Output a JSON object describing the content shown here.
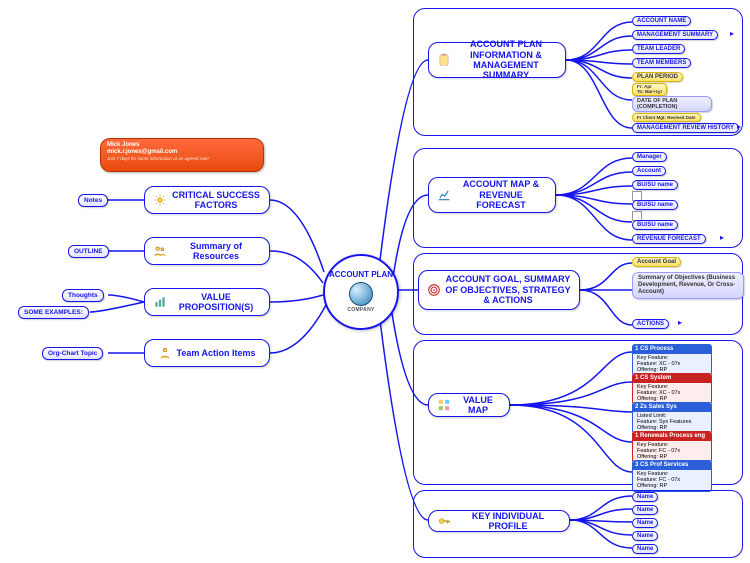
{
  "center": {
    "title": "ACCOUNT PLAN",
    "company": "COMPANY"
  },
  "contact": {
    "name": "Mick Jones",
    "email": "mick.r.jones@gmail.com",
    "note": "Just 7 days for some information at an agreed rate!"
  },
  "left": {
    "csf": {
      "title": "CRITICAL SUCCESS FACTORS",
      "child": "Notes"
    },
    "sor": {
      "title": "Summary of Resources",
      "child": "OUTLINE"
    },
    "vp": {
      "title": "VALUE PROPOSITION(S)",
      "child1": "Thoughts",
      "child2": "SOME EXAMPLES:"
    },
    "tai": {
      "title": "Team Action Items",
      "child": "Org-Chart Topic"
    }
  },
  "right": {
    "apims": {
      "title": "ACCOUNT PLAN INFORMATION & MANAGEMENT SUMMARY",
      "items": [
        "ACCOUNT NAME",
        "MANAGEMENT SUMMARY",
        "TEAM LEADER",
        "TEAM MEMBERS",
        "PLAN PERIOD",
        "DATE OF PLAN (COMPLETION)",
        "MANAGEMENT REVIEW HISTORY"
      ],
      "plan_period_sub": [
        "Fr: Apr",
        "To: Mar+1yr"
      ],
      "date_sub": "Fr Client Mgt: Revised Date"
    },
    "amrf": {
      "title": "ACCOUNT MAP & REVENUE FORECAST",
      "items": [
        "Manager",
        "Account",
        "BU/SU name",
        "BU/SU name",
        "BU/SU name",
        "REVENUE FORECAST"
      ]
    },
    "agsosa": {
      "title": "ACCOUNT GOAL, SUMMARY OF OBJECTIVES, STRATEGY & ACTIONS",
      "goal": "Account Goal",
      "summary": "Summary of Objectives (Business Development, Revenue, Or Cross-Account)",
      "actions": "ACTIONS"
    },
    "vmap": {
      "title": "VALUE MAP",
      "items": [
        {
          "n": "1",
          "t": "CS Process",
          "c": "blue",
          "l": "Key Feature:\nFeature: XC - 07x\nOffering: RP"
        },
        {
          "n": "1",
          "t": "CS System",
          "c": "red",
          "l": "Key Feature:\nFeature: XC - 07x\nOffering: RP"
        },
        {
          "n": "2",
          "t": "Zs Sales Sys",
          "c": "blue",
          "l": "Listed Limit:\nFeature: Sys Features\nOffering: RP"
        },
        {
          "n": "1",
          "t": "Renewals Process eng",
          "c": "red",
          "l": "Key Feature:\nFeature: FC - 07x\nOffering: RP"
        },
        {
          "n": "3",
          "t": "CS Prof Services",
          "c": "blue",
          "l": "Key Feature:\nFeature: FC - 07x\nOffering: RP"
        }
      ]
    },
    "kip": {
      "title": "KEY INDIVIDUAL PROFILE",
      "items": [
        "Name",
        "Name",
        "Name",
        "Name",
        "Name"
      ]
    }
  },
  "chart_data": {
    "type": "mindmap",
    "root": "ACCOUNT PLAN",
    "children": [
      {
        "side": "left",
        "label": "CRITICAL SUCCESS FACTORS",
        "children": [
          "Notes"
        ]
      },
      {
        "side": "left",
        "label": "Summary of Resources",
        "children": [
          "OUTLINE"
        ]
      },
      {
        "side": "left",
        "label": "VALUE PROPOSITION(S)",
        "children": [
          "Thoughts",
          "SOME EXAMPLES:"
        ]
      },
      {
        "side": "left",
        "label": "Team Action Items",
        "children": [
          "Org-Chart Topic"
        ]
      },
      {
        "side": "right",
        "label": "ACCOUNT PLAN INFORMATION & MANAGEMENT SUMMARY",
        "children": [
          "ACCOUNT NAME",
          "MANAGEMENT SUMMARY",
          "TEAM LEADER",
          "TEAM MEMBERS",
          "PLAN PERIOD",
          "DATE OF PLAN (COMPLETION)",
          "MANAGEMENT REVIEW HISTORY"
        ]
      },
      {
        "side": "right",
        "label": "ACCOUNT MAP & REVENUE FORECAST",
        "children": [
          "Manager",
          "Account",
          "BU/SU name",
          "BU/SU name",
          "BU/SU name",
          "REVENUE FORECAST"
        ]
      },
      {
        "side": "right",
        "label": "ACCOUNT GOAL, SUMMARY OF OBJECTIVES, STRATEGY & ACTIONS",
        "children": [
          "Account Goal",
          "Summary of Objectives (Business Development, Revenue, Or Cross-Account)",
          "ACTIONS"
        ]
      },
      {
        "side": "right",
        "label": "VALUE MAP",
        "children": [
          "1 CS Process",
          "1 CS System",
          "2 Zs Sales Sys",
          "1 Renewals Process eng",
          "3 CS Prof Services"
        ]
      },
      {
        "side": "right",
        "label": "KEY INDIVIDUAL PROFILE",
        "children": [
          "Name",
          "Name",
          "Name",
          "Name",
          "Name"
        ]
      }
    ]
  }
}
